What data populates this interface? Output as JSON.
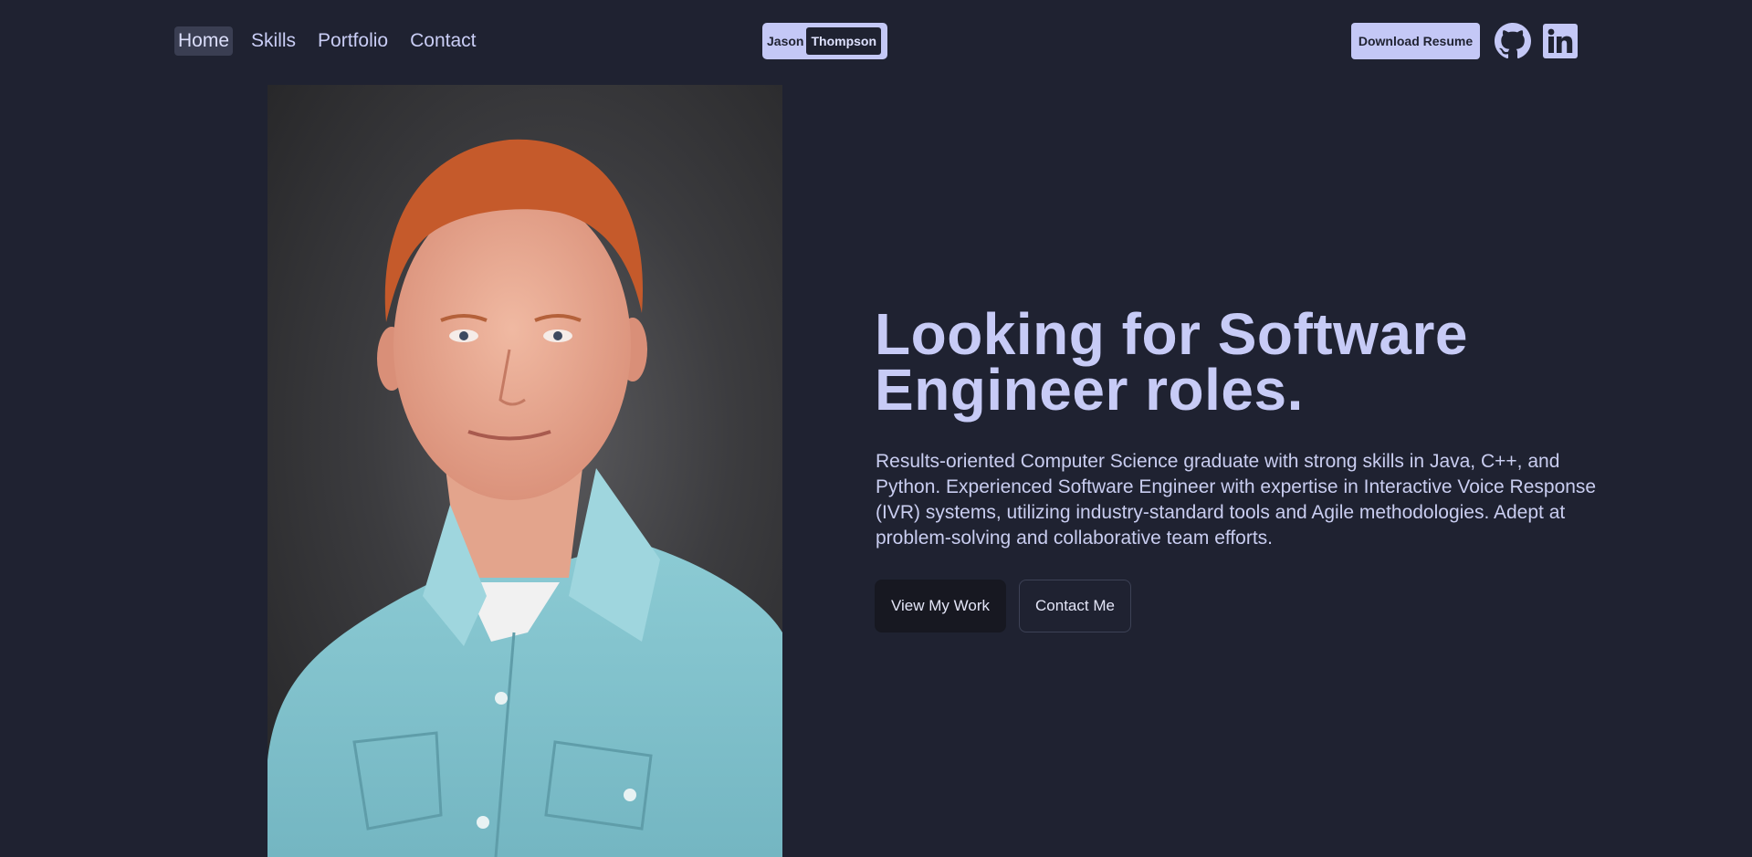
{
  "nav": {
    "items": [
      {
        "label": "Home",
        "active": true
      },
      {
        "label": "Skills",
        "active": false
      },
      {
        "label": "Portfolio",
        "active": false
      },
      {
        "label": "Contact",
        "active": false
      }
    ]
  },
  "brand": {
    "first": "Jason",
    "last": "Thompson"
  },
  "header": {
    "download_label": "Download Resume",
    "social": [
      "github-icon",
      "linkedin-icon"
    ]
  },
  "portrait": {
    "description_icon": "portrait-photo"
  },
  "hero": {
    "title": "Looking for Software Engineer roles.",
    "description": "Results-oriented Computer Science graduate with strong skills in Java, C++, and Python. Experienced Software Engineer with expertise in Interactive Voice Response (IVR) systems, utilizing industry-standard tools and Agile methodologies. Adept at problem-solving and collaborative team efforts.",
    "primary_cta": "View My Work",
    "secondary_cta": "Contact Me"
  },
  "colors": {
    "background": "#1f2231",
    "accent": "#c4c8f6",
    "text": "#c9cdf5",
    "button_dark": "#171821"
  }
}
